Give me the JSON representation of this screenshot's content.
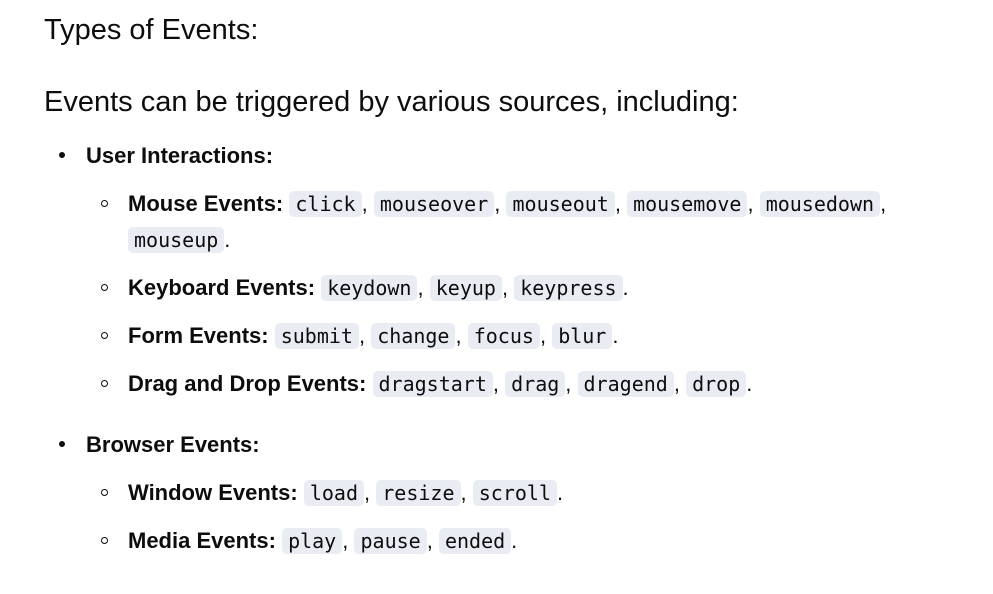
{
  "heading": "Types of Events:",
  "intro": "Events can be triggered by various sources, including:",
  "groups": [
    {
      "label": "User Interactions:",
      "items": [
        {
          "label": "Mouse Events:",
          "codes": [
            "click",
            "mouseover",
            "mouseout",
            "mousemove",
            "mousedown",
            "mouseup"
          ]
        },
        {
          "label": "Keyboard Events:",
          "codes": [
            "keydown",
            "keyup",
            "keypress"
          ]
        },
        {
          "label": "Form Events:",
          "codes": [
            "submit",
            "change",
            "focus",
            "blur"
          ]
        },
        {
          "label": "Drag and Drop Events:",
          "codes": [
            "dragstart",
            "drag",
            "dragend",
            "drop"
          ]
        }
      ]
    },
    {
      "label": "Browser Events:",
      "items": [
        {
          "label": "Window Events:",
          "codes": [
            "load",
            "resize",
            "scroll"
          ]
        },
        {
          "label": "Media Events:",
          "codes": [
            "play",
            "pause",
            "ended"
          ]
        }
      ]
    }
  ],
  "separators": {
    "comma": ",",
    "period": "."
  }
}
